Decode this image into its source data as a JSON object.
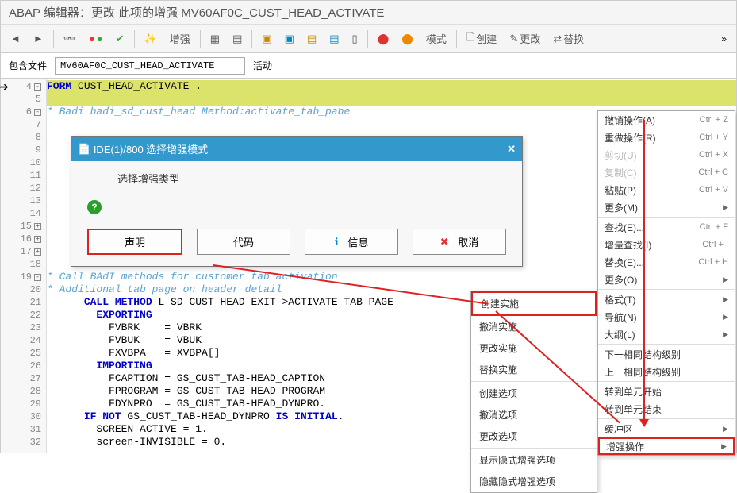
{
  "title": "ABAP 编辑器：更改 此项的增强 MV60AF0C_CUST_HEAD_ACTIVATE",
  "toolbar": {
    "enhance": "增强",
    "mode": "模式",
    "create": "创建",
    "change": "更改",
    "replace": "替换"
  },
  "file_row": {
    "label": "包含文件",
    "value": "MV60AF0C_CUST_HEAD_ACTIVATE",
    "status": "活动"
  },
  "modal": {
    "title": "IDE(1)/800 选择增强模式",
    "prompt": "选择增强类型",
    "btn_declare": "声明",
    "btn_code": "代码",
    "btn_info": "信息",
    "btn_cancel": "取消"
  },
  "ctx1": {
    "items": [
      "创建实施",
      "撤消实施",
      "更改实施",
      "替换实施",
      "创建选项",
      "撤消选项",
      "更改选项",
      "显示隐式增强选项",
      "隐藏隐式增强选项"
    ]
  },
  "ctx2": {
    "rows": [
      {
        "label": "撤销操作(A)",
        "sc": "Ctrl + Z"
      },
      {
        "label": "重做操作(R)",
        "sc": "Ctrl + Y"
      },
      {
        "label": "剪切(U)",
        "sc": "Ctrl + X",
        "dis": true
      },
      {
        "label": "复制(C)",
        "sc": "Ctrl + C",
        "dis": true
      },
      {
        "label": "粘贴(P)",
        "sc": "Ctrl + V"
      },
      {
        "label": "更多(M)",
        "arr": true
      },
      {
        "sep": true
      },
      {
        "label": "查找(E)...",
        "sc": "Ctrl + F"
      },
      {
        "label": "增量查找(I)",
        "sc": "Ctrl + I"
      },
      {
        "label": "替换(E)...",
        "sc": "Ctrl + H"
      },
      {
        "label": "更多(O)",
        "arr": true
      },
      {
        "sep": true
      },
      {
        "label": "格式(T)",
        "arr": true
      },
      {
        "label": "导航(N)",
        "arr": true
      },
      {
        "label": "大纲(L)",
        "arr": true
      },
      {
        "sep": true
      },
      {
        "label": "下一相同结构级别"
      },
      {
        "label": "上一相同结构级别"
      },
      {
        "sep": true
      },
      {
        "label": "转到单元开始"
      },
      {
        "label": "转到单元结束"
      },
      {
        "sep": true
      },
      {
        "label": "缓冲区",
        "arr": true
      },
      {
        "label": "增强操作",
        "arr": true,
        "hl": true
      }
    ]
  },
  "code": {
    "lines": [
      {
        "n": 4,
        "html": "<span class='kw'>FORM</span> CUST_HEAD_ACTIVATE .",
        "hl": true,
        "fold": "-"
      },
      {
        "n": 5,
        "html": "",
        "hl": true
      },
      {
        "n": 6,
        "html": "<span class='cm'>* Badi badi_sd_cust_head Method:activate_tab_pabe</span>",
        "fold": "-"
      },
      {
        "n": 7,
        "html": ""
      },
      {
        "n": 8,
        "html": ""
      },
      {
        "n": 9,
        "html": ""
      },
      {
        "n": 10,
        "html": ""
      },
      {
        "n": 11,
        "html": ""
      },
      {
        "n": 12,
        "html": ""
      },
      {
        "n": 13,
        "html": ""
      },
      {
        "n": 14,
        "html": ""
      },
      {
        "n": 15,
        "html": "",
        "fold": "+"
      },
      {
        "n": 16,
        "html": "",
        "fold": "+"
      },
      {
        "n": 17,
        "html": "",
        "fold": "+"
      },
      {
        "n": 18,
        "html": ""
      },
      {
        "n": 19,
        "html": "<span class='cm'>* Call BAdI methods for customer tab activation</span>",
        "fold": "-"
      },
      {
        "n": 20,
        "html": "<span class='cm'>* Additional tab page on header detail</span>"
      },
      {
        "n": 21,
        "html": "      <span class='kw'>CALL METHOD</span> L_SD_CUST_HEAD_EXIT-&gt;ACTIVATE_TAB_PAGE"
      },
      {
        "n": 22,
        "html": "        <span class='kw'>EXPORTING</span>"
      },
      {
        "n": 23,
        "html": "          FVBRK    = VBRK"
      },
      {
        "n": 24,
        "html": "          FVBUK    = VBUK"
      },
      {
        "n": 25,
        "html": "          FXVBPA   = XVBPA[]"
      },
      {
        "n": 26,
        "html": "        <span class='kw'>IMPORTING</span>"
      },
      {
        "n": 27,
        "html": "          FCAPTION = GS_CUST_TAB-HEAD_CAPTION"
      },
      {
        "n": 28,
        "html": "          FPROGRAM = GS_CUST_TAB-HEAD_PROGRAM"
      },
      {
        "n": 29,
        "html": "          FDYNPRO  = GS_CUST_TAB-HEAD_DYNPRO."
      },
      {
        "n": 30,
        "html": "      <span class='kw'>IF NOT</span> GS_CUST_TAB-HEAD_DYNPRO <span class='kw'>IS INITIAL</span>."
      },
      {
        "n": 31,
        "html": "        SCREEN-ACTIVE = 1."
      },
      {
        "n": 32,
        "html": "        screen-INVISIBLE = 0."
      }
    ]
  }
}
